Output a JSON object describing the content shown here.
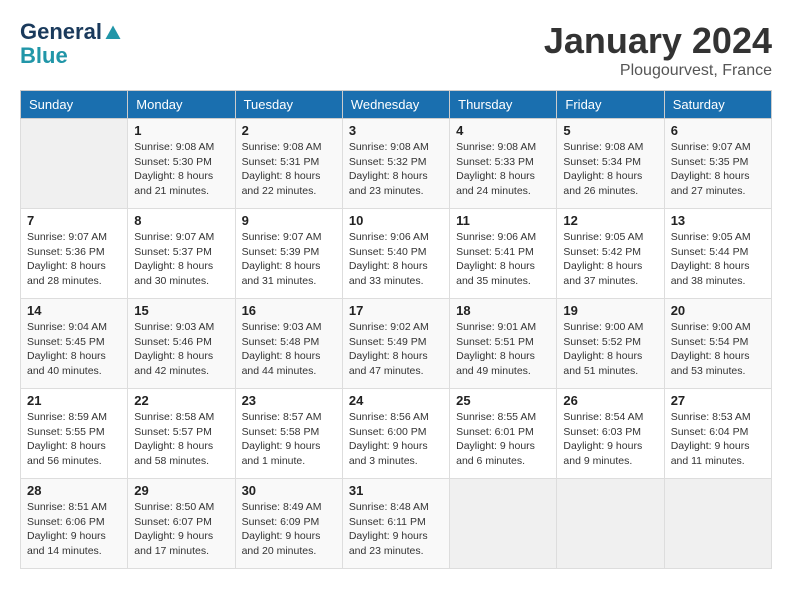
{
  "header": {
    "logo_line1": "General",
    "logo_line2": "Blue",
    "month": "January 2024",
    "location": "Plougourvest, France"
  },
  "weekdays": [
    "Sunday",
    "Monday",
    "Tuesday",
    "Wednesday",
    "Thursday",
    "Friday",
    "Saturday"
  ],
  "weeks": [
    [
      {
        "day": "",
        "sunrise": "",
        "sunset": "",
        "daylight": ""
      },
      {
        "day": "1",
        "sunrise": "Sunrise: 9:08 AM",
        "sunset": "Sunset: 5:30 PM",
        "daylight": "Daylight: 8 hours and 21 minutes."
      },
      {
        "day": "2",
        "sunrise": "Sunrise: 9:08 AM",
        "sunset": "Sunset: 5:31 PM",
        "daylight": "Daylight: 8 hours and 22 minutes."
      },
      {
        "day": "3",
        "sunrise": "Sunrise: 9:08 AM",
        "sunset": "Sunset: 5:32 PM",
        "daylight": "Daylight: 8 hours and 23 minutes."
      },
      {
        "day": "4",
        "sunrise": "Sunrise: 9:08 AM",
        "sunset": "Sunset: 5:33 PM",
        "daylight": "Daylight: 8 hours and 24 minutes."
      },
      {
        "day": "5",
        "sunrise": "Sunrise: 9:08 AM",
        "sunset": "Sunset: 5:34 PM",
        "daylight": "Daylight: 8 hours and 26 minutes."
      },
      {
        "day": "6",
        "sunrise": "Sunrise: 9:07 AM",
        "sunset": "Sunset: 5:35 PM",
        "daylight": "Daylight: 8 hours and 27 minutes."
      }
    ],
    [
      {
        "day": "7",
        "sunrise": "Sunrise: 9:07 AM",
        "sunset": "Sunset: 5:36 PM",
        "daylight": "Daylight: 8 hours and 28 minutes."
      },
      {
        "day": "8",
        "sunrise": "Sunrise: 9:07 AM",
        "sunset": "Sunset: 5:37 PM",
        "daylight": "Daylight: 8 hours and 30 minutes."
      },
      {
        "day": "9",
        "sunrise": "Sunrise: 9:07 AM",
        "sunset": "Sunset: 5:39 PM",
        "daylight": "Daylight: 8 hours and 31 minutes."
      },
      {
        "day": "10",
        "sunrise": "Sunrise: 9:06 AM",
        "sunset": "Sunset: 5:40 PM",
        "daylight": "Daylight: 8 hours and 33 minutes."
      },
      {
        "day": "11",
        "sunrise": "Sunrise: 9:06 AM",
        "sunset": "Sunset: 5:41 PM",
        "daylight": "Daylight: 8 hours and 35 minutes."
      },
      {
        "day": "12",
        "sunrise": "Sunrise: 9:05 AM",
        "sunset": "Sunset: 5:42 PM",
        "daylight": "Daylight: 8 hours and 37 minutes."
      },
      {
        "day": "13",
        "sunrise": "Sunrise: 9:05 AM",
        "sunset": "Sunset: 5:44 PM",
        "daylight": "Daylight: 8 hours and 38 minutes."
      }
    ],
    [
      {
        "day": "14",
        "sunrise": "Sunrise: 9:04 AM",
        "sunset": "Sunset: 5:45 PM",
        "daylight": "Daylight: 8 hours and 40 minutes."
      },
      {
        "day": "15",
        "sunrise": "Sunrise: 9:03 AM",
        "sunset": "Sunset: 5:46 PM",
        "daylight": "Daylight: 8 hours and 42 minutes."
      },
      {
        "day": "16",
        "sunrise": "Sunrise: 9:03 AM",
        "sunset": "Sunset: 5:48 PM",
        "daylight": "Daylight: 8 hours and 44 minutes."
      },
      {
        "day": "17",
        "sunrise": "Sunrise: 9:02 AM",
        "sunset": "Sunset: 5:49 PM",
        "daylight": "Daylight: 8 hours and 47 minutes."
      },
      {
        "day": "18",
        "sunrise": "Sunrise: 9:01 AM",
        "sunset": "Sunset: 5:51 PM",
        "daylight": "Daylight: 8 hours and 49 minutes."
      },
      {
        "day": "19",
        "sunrise": "Sunrise: 9:00 AM",
        "sunset": "Sunset: 5:52 PM",
        "daylight": "Daylight: 8 hours and 51 minutes."
      },
      {
        "day": "20",
        "sunrise": "Sunrise: 9:00 AM",
        "sunset": "Sunset: 5:54 PM",
        "daylight": "Daylight: 8 hours and 53 minutes."
      }
    ],
    [
      {
        "day": "21",
        "sunrise": "Sunrise: 8:59 AM",
        "sunset": "Sunset: 5:55 PM",
        "daylight": "Daylight: 8 hours and 56 minutes."
      },
      {
        "day": "22",
        "sunrise": "Sunrise: 8:58 AM",
        "sunset": "Sunset: 5:57 PM",
        "daylight": "Daylight: 8 hours and 58 minutes."
      },
      {
        "day": "23",
        "sunrise": "Sunrise: 8:57 AM",
        "sunset": "Sunset: 5:58 PM",
        "daylight": "Daylight: 9 hours and 1 minute."
      },
      {
        "day": "24",
        "sunrise": "Sunrise: 8:56 AM",
        "sunset": "Sunset: 6:00 PM",
        "daylight": "Daylight: 9 hours and 3 minutes."
      },
      {
        "day": "25",
        "sunrise": "Sunrise: 8:55 AM",
        "sunset": "Sunset: 6:01 PM",
        "daylight": "Daylight: 9 hours and 6 minutes."
      },
      {
        "day": "26",
        "sunrise": "Sunrise: 8:54 AM",
        "sunset": "Sunset: 6:03 PM",
        "daylight": "Daylight: 9 hours and 9 minutes."
      },
      {
        "day": "27",
        "sunrise": "Sunrise: 8:53 AM",
        "sunset": "Sunset: 6:04 PM",
        "daylight": "Daylight: 9 hours and 11 minutes."
      }
    ],
    [
      {
        "day": "28",
        "sunrise": "Sunrise: 8:51 AM",
        "sunset": "Sunset: 6:06 PM",
        "daylight": "Daylight: 9 hours and 14 minutes."
      },
      {
        "day": "29",
        "sunrise": "Sunrise: 8:50 AM",
        "sunset": "Sunset: 6:07 PM",
        "daylight": "Daylight: 9 hours and 17 minutes."
      },
      {
        "day": "30",
        "sunrise": "Sunrise: 8:49 AM",
        "sunset": "Sunset: 6:09 PM",
        "daylight": "Daylight: 9 hours and 20 minutes."
      },
      {
        "day": "31",
        "sunrise": "Sunrise: 8:48 AM",
        "sunset": "Sunset: 6:11 PM",
        "daylight": "Daylight: 9 hours and 23 minutes."
      },
      {
        "day": "",
        "sunrise": "",
        "sunset": "",
        "daylight": ""
      },
      {
        "day": "",
        "sunrise": "",
        "sunset": "",
        "daylight": ""
      },
      {
        "day": "",
        "sunrise": "",
        "sunset": "",
        "daylight": ""
      }
    ]
  ]
}
